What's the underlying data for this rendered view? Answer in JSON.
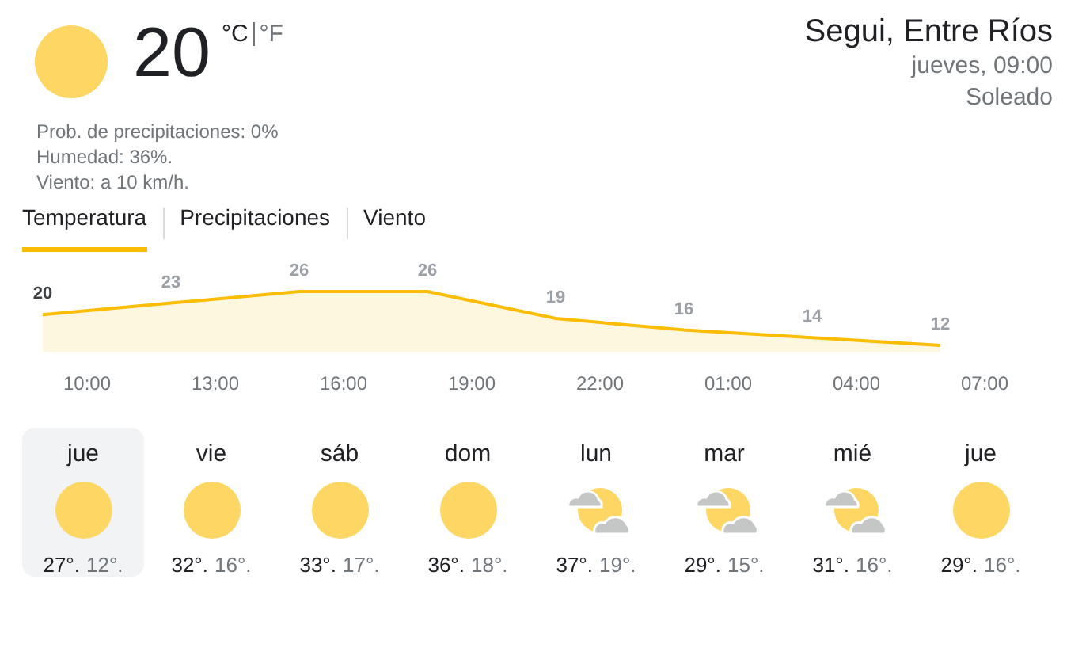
{
  "current": {
    "temperature": "20",
    "units": [
      {
        "label": "°C",
        "selected": true
      },
      {
        "label": "°F",
        "selected": false
      }
    ],
    "details": [
      "Prob. de precipitaciones: 0%",
      "Humedad: 36%.",
      "Viento: a 10 km/h."
    ]
  },
  "location": {
    "name": "Segui, Entre Ríos",
    "time": "jueves, 09:00",
    "condition": "Soleado"
  },
  "tabs": [
    {
      "label": "Temperatura",
      "selected": true
    },
    {
      "label": "Precipitaciones",
      "selected": false
    },
    {
      "label": "Viento",
      "selected": false
    }
  ],
  "chart": {
    "chart_data": {
      "type": "area",
      "categories": [
        null,
        null,
        null,
        null,
        null,
        null,
        null,
        null
      ],
      "series": [
        {
          "color": "#fbbc04",
          "values": [
            20,
            23,
            26,
            26,
            19,
            16,
            14,
            12
          ]
        }
      ],
      "data_labels": true
    },
    "hours": [
      "10:00",
      "13:00",
      "16:00",
      "19:00",
      "22:00",
      "01:00",
      "04:00",
      "07:00"
    ]
  },
  "days": [
    {
      "day": "jue",
      "kind": "sunny",
      "high": "27°.",
      "low": "12°.",
      "selected": true
    },
    {
      "day": "vie",
      "kind": "sunny",
      "high": "32°.",
      "low": "16°.",
      "selected": false
    },
    {
      "day": "sáb",
      "kind": "sunny",
      "high": "33°.",
      "low": "17°.",
      "selected": false
    },
    {
      "day": "dom",
      "kind": "sunny",
      "high": "36°.",
      "low": "18°.",
      "selected": false
    },
    {
      "day": "lun",
      "kind": "partly-cloudy",
      "high": "37°.",
      "low": "19°.",
      "selected": false
    },
    {
      "day": "mar",
      "kind": "partly-cloudy",
      "high": "29°.",
      "low": "15°.",
      "selected": false
    },
    {
      "day": "mié",
      "kind": "partly-cloudy",
      "high": "31°.",
      "low": "16°.",
      "selected": false
    },
    {
      "day": "jue",
      "kind": "sunny",
      "high": "29°.",
      "low": "16°.",
      "selected": false
    }
  ]
}
